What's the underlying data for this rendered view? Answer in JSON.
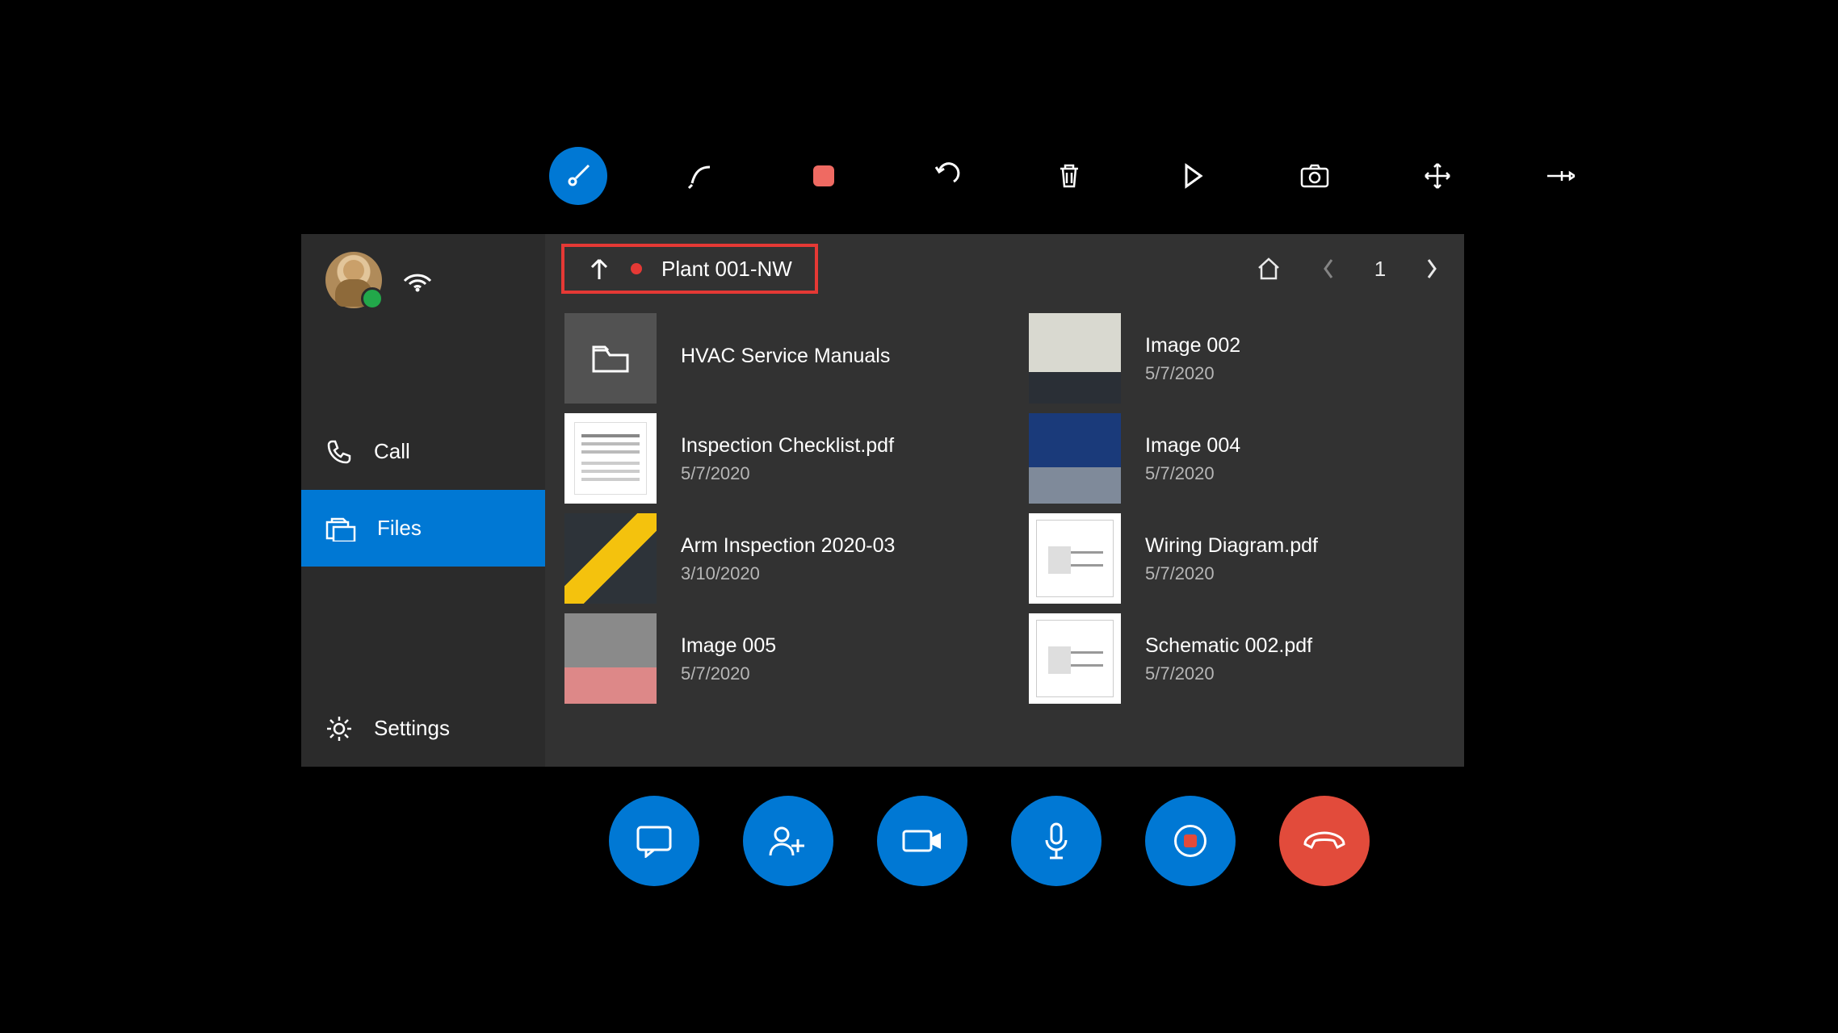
{
  "toolbar": {
    "items": [
      {
        "name": "laser-pointer",
        "active": true
      },
      {
        "name": "ink",
        "active": false
      },
      {
        "name": "stop-record",
        "active": false
      },
      {
        "name": "undo",
        "active": false
      },
      {
        "name": "delete",
        "active": false
      },
      {
        "name": "play",
        "active": false
      },
      {
        "name": "camera",
        "active": false
      },
      {
        "name": "move",
        "active": false
      },
      {
        "name": "pin",
        "active": false
      }
    ]
  },
  "sidebar": {
    "call_label": "Call",
    "files_label": "Files",
    "settings_label": "Settings"
  },
  "breadcrumb": {
    "title": "Plant 001-NW",
    "page": "1"
  },
  "files": {
    "left": [
      {
        "name": "HVAC Service Manuals",
        "date": "",
        "type": "folder"
      },
      {
        "name": "Inspection Checklist.pdf",
        "date": "5/7/2020",
        "type": "doc"
      },
      {
        "name": "Arm Inspection 2020-03",
        "date": "3/10/2020",
        "type": "photo-arm"
      },
      {
        "name": "Image 005",
        "date": "5/7/2020",
        "type": "photo-fact"
      }
    ],
    "right": [
      {
        "name": "Image 002",
        "date": "5/7/2020",
        "type": "photo-cart"
      },
      {
        "name": "Image 004",
        "date": "5/7/2020",
        "type": "photo-blue"
      },
      {
        "name": "Wiring Diagram.pdf",
        "date": "5/7/2020",
        "type": "schematic"
      },
      {
        "name": "Schematic 002.pdf",
        "date": "5/7/2020",
        "type": "schematic"
      }
    ]
  },
  "callbar": {
    "buttons": [
      "chat",
      "people",
      "video",
      "mic",
      "record",
      "end"
    ]
  }
}
